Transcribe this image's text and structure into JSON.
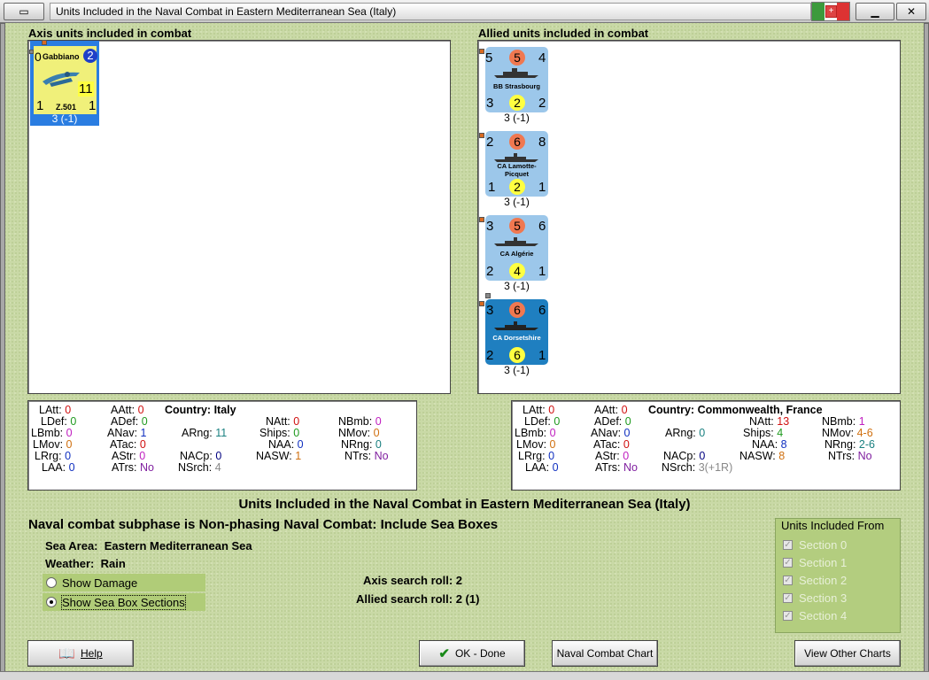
{
  "window": {
    "title": "Units Included in the Naval Combat in Eastern Mediterranean Sea (Italy)"
  },
  "axis_panel": {
    "label": "Axis units included in combat",
    "units": [
      {
        "name": "Gabbiano",
        "type": "Z.501",
        "top_left": "0",
        "top_right": "2",
        "big": "11",
        "bottom_left": "1",
        "bottom_right": "1",
        "strength": "3 (-1)"
      }
    ]
  },
  "allied_panel": {
    "label": "Allied units included in combat",
    "units": [
      {
        "name": "BB Strasbourg",
        "tl": "5",
        "tc": "5",
        "tr": "4",
        "bl": "3",
        "bc": "2",
        "br": "2",
        "strength": "3 (-1)"
      },
      {
        "name": "CA Lamotte-Picquet",
        "tl": "2",
        "tc": "6",
        "tr": "8",
        "bl": "1",
        "bc": "2",
        "br": "1",
        "strength": "3 (-1)"
      },
      {
        "name": "CA Algérie",
        "tl": "3",
        "tc": "5",
        "tr": "6",
        "bl": "2",
        "bc": "4",
        "br": "1",
        "strength": "3 (-1)"
      },
      {
        "name": "CA Dorsetshire",
        "tl": "3",
        "tc": "6",
        "tr": "6",
        "bl": "2",
        "bc": "6",
        "br": "1",
        "strength": "3 (-1)"
      }
    ]
  },
  "axis_stats": {
    "country_label": "Country:",
    "country": "Italy",
    "latt": "0",
    "ldef": "0",
    "lbmb": "0",
    "lmov": "0",
    "lrrg": "0",
    "laa": "0",
    "aatt": "0",
    "adef": "0",
    "anav": "1",
    "atac": "0",
    "astr": "0",
    "atrs": "No",
    "arng": "11",
    "nacp": "0",
    "nsrch": "4",
    "natt": "0",
    "ships": "0",
    "naa": "0",
    "nasw": "1",
    "nbmb": "0",
    "nmov": "0",
    "nrng": "0",
    "ntrs": "No"
  },
  "allied_stats": {
    "country_label": "Country:",
    "country": "Commonwealth, France",
    "latt": "0",
    "ldef": "0",
    "lbmb": "0",
    "lmov": "0",
    "lrrg": "0",
    "laa": "0",
    "aatt": "0",
    "adef": "0",
    "anav": "0",
    "atac": "0",
    "astr": "0",
    "atrs": "No",
    "arng": "0",
    "nacp": "0",
    "nsrch": "3(+1R)",
    "natt": "13",
    "ships": "4",
    "naa": "8",
    "nasw": "8",
    "nbmb": "1",
    "nmov": "4-6",
    "nrng": "2-6",
    "ntrs": "No"
  },
  "labels": {
    "latt": "LAtt:",
    "ldef": "LDef:",
    "lbmb": "LBmb:",
    "lmov": "LMov:",
    "lrrg": "LRrg:",
    "laa": "LAA:",
    "aatt": "AAtt:",
    "adef": "ADef:",
    "anav": "ANav:",
    "atac": "ATac:",
    "astr": "AStr:",
    "atrs": "ATrs:",
    "arng": "ARng:",
    "nacp": "NACp:",
    "nsrch": "NSrch:",
    "natt": "NAtt:",
    "ships": "Ships:",
    "naa": "NAA:",
    "nasw": "NASW:",
    "nbmb": "NBmb:",
    "nmov": "NMov:",
    "nrng": "NRng:",
    "ntrs": "NTrs:"
  },
  "info": {
    "heading": "Units Included in the Naval Combat in Eastern Mediterranean Sea (Italy)",
    "subphase": "Naval combat subphase is Non-phasing Naval Combat: Include Sea Boxes",
    "sea_area_label": "Sea Area:",
    "sea_area": "Eastern Mediterranean Sea",
    "weather_label": "Weather:",
    "weather": "Rain",
    "axis_roll_label": "Axis search roll:",
    "axis_roll": "2",
    "allied_roll_label": "Allied search roll:",
    "allied_roll": "2 (1)"
  },
  "options": {
    "show_damage": "Show Damage",
    "show_sea_box": "Show Sea Box Sections"
  },
  "units_from": {
    "title": "Units Included From",
    "sections": [
      "Section 0",
      "Section 1",
      "Section 2",
      "Section 3",
      "Section 4"
    ]
  },
  "buttons": {
    "help": "Help",
    "ok": "OK - Done",
    "naval_chart": "Naval Combat Chart",
    "other_charts": "View Other Charts"
  }
}
